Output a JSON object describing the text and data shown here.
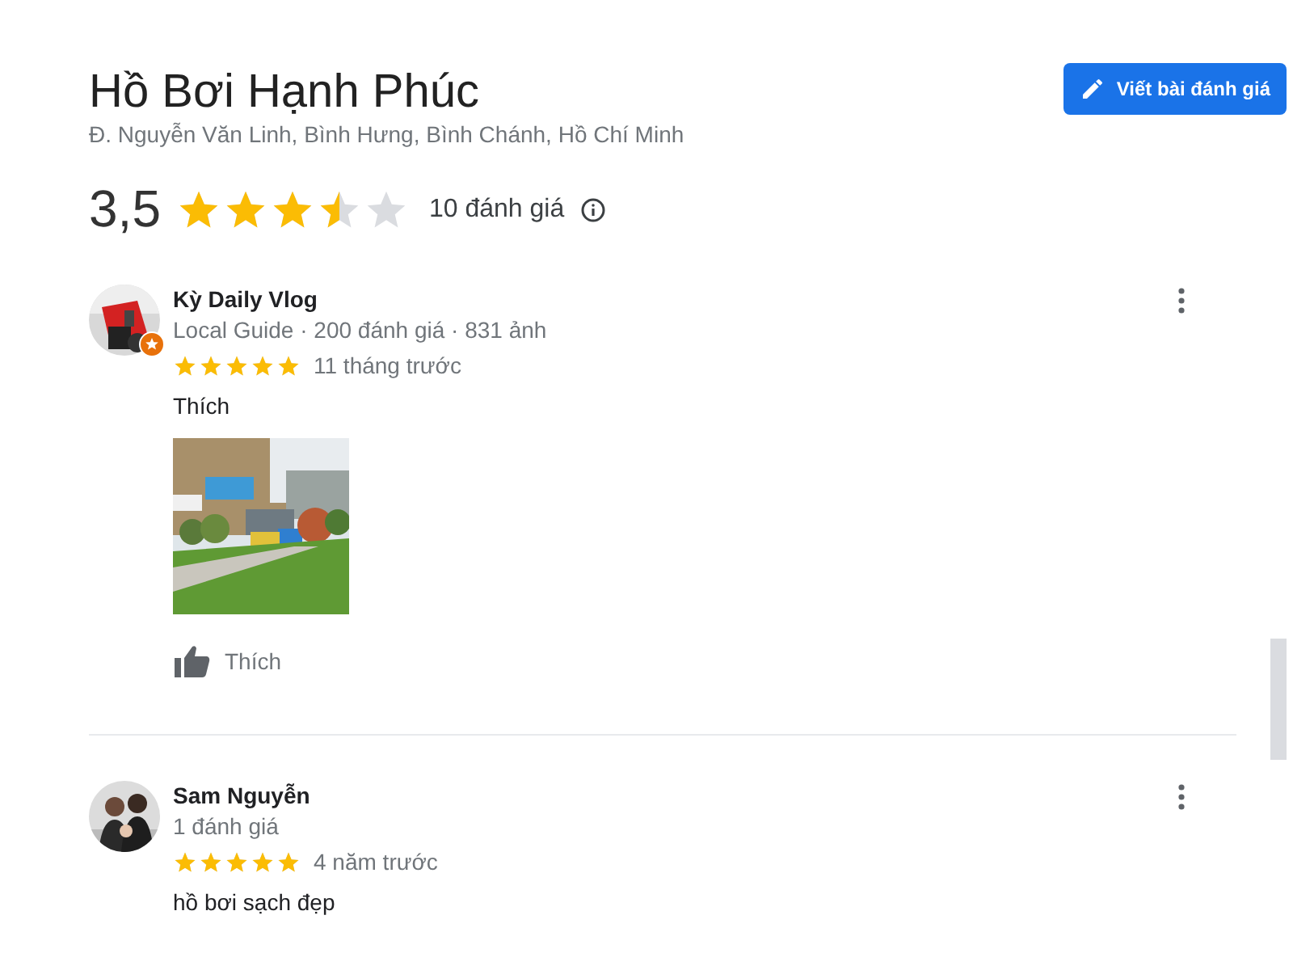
{
  "place": {
    "title": "Hồ Bơi Hạnh Phúc",
    "address": "Đ. Nguyễn Văn Linh, Bình Hưng, Bình Chánh, Hồ Chí Minh",
    "rating": "3,5",
    "stars": 3.5,
    "review_count": "10 đánh giá"
  },
  "write_review_button": "Viết bài đánh giá",
  "reviews": [
    {
      "author": "Kỳ Daily Vlog",
      "local_guide": true,
      "meta": "Local Guide · 200 đánh giá · 831 ảnh",
      "stars": 5,
      "time": "11 tháng trước",
      "text": "Thích",
      "photos": [
        {
          "kind": "picture"
        }
      ],
      "like_label": "Thích"
    },
    {
      "author": "Sam Nguyễn",
      "local_guide": false,
      "meta": "1 đánh giá",
      "stars": 5,
      "time": "4 năm trước",
      "text": "hồ bơi sạch đẹp"
    }
  ]
}
